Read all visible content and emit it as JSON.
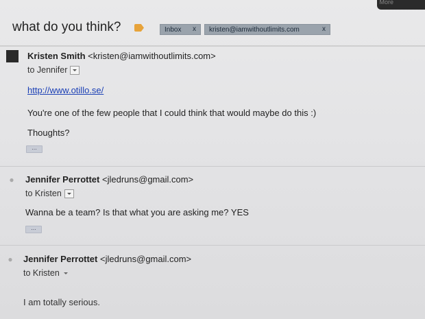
{
  "subject": "what do you think?",
  "labels": [
    {
      "text": "Inbox",
      "close": "x"
    },
    {
      "text": "kristen@iamwithoutlimits.com",
      "close": "x"
    }
  ],
  "top_bar": {
    "more": "More"
  },
  "messages": [
    {
      "sender_name": "Kristen Smith",
      "sender_email": "<kristen@iamwithoutlimits.com>",
      "to": "to Jennifer",
      "link": "http://www.otillo.se/",
      "lines": [
        "You're one of the few people that I could think that would maybe do this :)",
        "Thoughts?"
      ],
      "ellipsis": "..."
    },
    {
      "sender_name": "Jennifer Perrottet",
      "sender_email": "<jledruns@gmail.com>",
      "to": "to Kristen",
      "lines": [
        "Wanna be a team? Is that what you are asking me? YES"
      ],
      "ellipsis": "..."
    },
    {
      "sender_name": "Jennifer Perrottet",
      "sender_email": "<jledruns@gmail.com>",
      "to": "to Kristen",
      "lines": [
        "I am totally serious."
      ]
    }
  ]
}
